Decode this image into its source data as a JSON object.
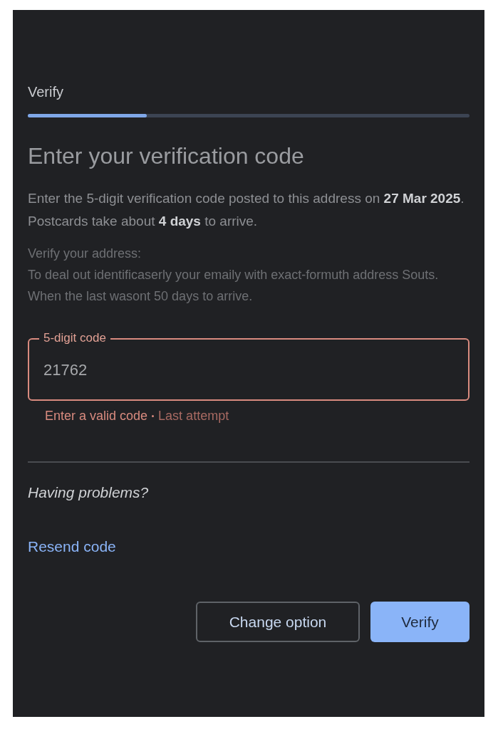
{
  "header": {
    "title": "Verify",
    "progress": {
      "level": 0.27
    }
  },
  "heading": "Enter your verification code",
  "intro": "Enter the 5-digit verification code posted to this address on **27 Mar 2025**. Postcards take about **4 days** to arrive.",
  "note": {
    "title": "Verify your address:",
    "body": "To deal out identificaserly your emaily with exact-formuth address Souts. When the last wasont 50 days to arrive."
  },
  "code_field": {
    "label": "5-digit code",
    "value": "21762",
    "error": true,
    "error_text": "Enter a valid code",
    "error_detail": "Last attempt"
  },
  "help": {
    "title": "Having problems?",
    "link": "Resend code"
  },
  "buttons": [
    {
      "label": "Change option",
      "kind": "outlined"
    },
    {
      "label": "Verify",
      "kind": "filled"
    }
  ]
}
